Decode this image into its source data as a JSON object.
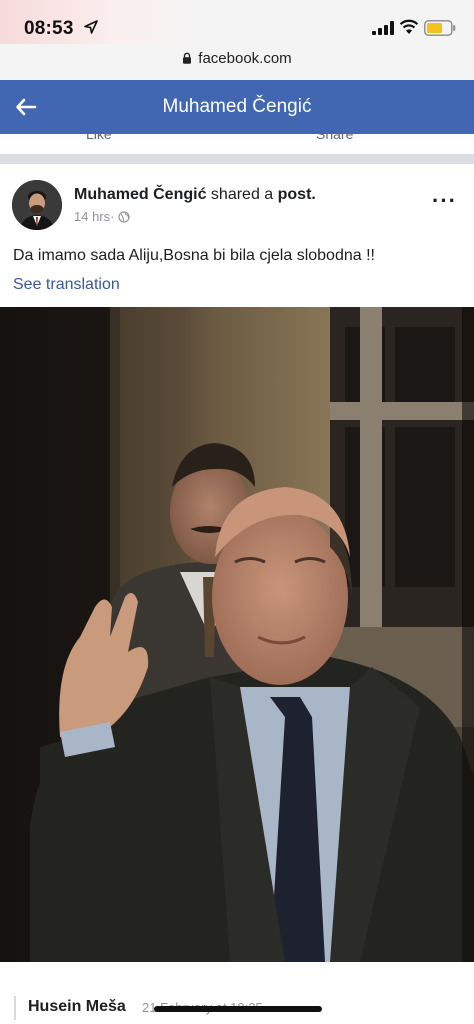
{
  "status_bar": {
    "time": "08:53"
  },
  "browser": {
    "url": "facebook.com"
  },
  "header": {
    "title": "Muhamed Čengić"
  },
  "prev_post": {
    "like_label": "Like",
    "share_label": "Share"
  },
  "post": {
    "author": "Muhamed Čengić",
    "action_text": " shared a ",
    "object_label": "post.",
    "time": "14 hrs",
    "separator": " · ",
    "text": "Da imamo sada Aliju,Bosna bi bila cjela slobodna !!",
    "translation_link": "See translation",
    "more_label": "···"
  },
  "comment_preview": {
    "author": "Husein Meša",
    "time": "21 February at 18:25"
  },
  "colors": {
    "fb_blue": "#4267b2",
    "link": "#385898",
    "meta": "#90949c"
  },
  "icons": [
    "location-arrow-icon",
    "signal-icon",
    "wifi-icon",
    "battery-icon",
    "lock-icon",
    "back-arrow-icon",
    "globe-icon",
    "more-icon"
  ]
}
